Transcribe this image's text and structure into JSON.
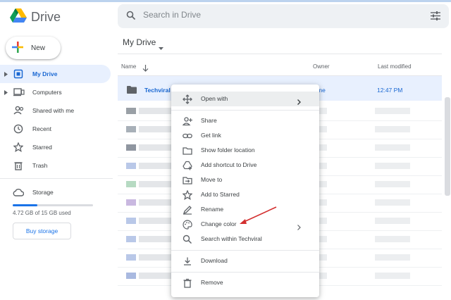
{
  "app": {
    "title": "Drive"
  },
  "search": {
    "placeholder": "Search in Drive"
  },
  "new_button": {
    "label": "New"
  },
  "sidebar": {
    "items": [
      {
        "label": "My Drive",
        "icon": "my-drive-icon",
        "active": true,
        "expandable": true
      },
      {
        "label": "Computers",
        "icon": "computers-icon",
        "active": false,
        "expandable": true
      },
      {
        "label": "Shared with me",
        "icon": "shared-icon",
        "active": false,
        "expandable": false
      },
      {
        "label": "Recent",
        "icon": "clock-icon",
        "active": false,
        "expandable": false
      },
      {
        "label": "Starred",
        "icon": "star-icon",
        "active": false,
        "expandable": false
      },
      {
        "label": "Trash",
        "icon": "trash-icon",
        "active": false,
        "expandable": false
      }
    ],
    "storage": {
      "label": "Storage",
      "used_text": "4.72 GB of 15 GB used",
      "used_fraction": 0.31,
      "buy_label": "Buy storage"
    }
  },
  "main": {
    "breadcrumb": "My Drive",
    "columns": {
      "name": "Name",
      "owner": "Owner",
      "last_modified": "Last modified"
    },
    "selected_row": {
      "name": "Techviral",
      "owner": "me",
      "modified": "12:47 PM"
    }
  },
  "context_menu": {
    "items": [
      {
        "label": "Open with",
        "icon": "move-icon",
        "submenu": true,
        "hover": true
      },
      {
        "label": "Share",
        "icon": "person-add-icon"
      },
      {
        "label": "Get link",
        "icon": "link-icon"
      },
      {
        "label": "Show folder location",
        "icon": "folder-icon"
      },
      {
        "label": "Add shortcut to Drive",
        "icon": "add-to-drive-icon"
      },
      {
        "label": "Move to",
        "icon": "move-to-icon"
      },
      {
        "label": "Add to Starred",
        "icon": "star-icon"
      },
      {
        "label": "Rename",
        "icon": "pencil-icon"
      },
      {
        "label": "Change color",
        "icon": "palette-icon",
        "submenu": true
      },
      {
        "label": "Search within Techviral",
        "icon": "search-icon"
      },
      {
        "label": "Download",
        "icon": "download-icon"
      },
      {
        "label": "Remove",
        "icon": "trash-icon"
      }
    ]
  },
  "colors": {
    "accent": "#1a73e8",
    "selected_bg": "#e8f0fe",
    "annotation_arrow": "#d32f2f"
  }
}
